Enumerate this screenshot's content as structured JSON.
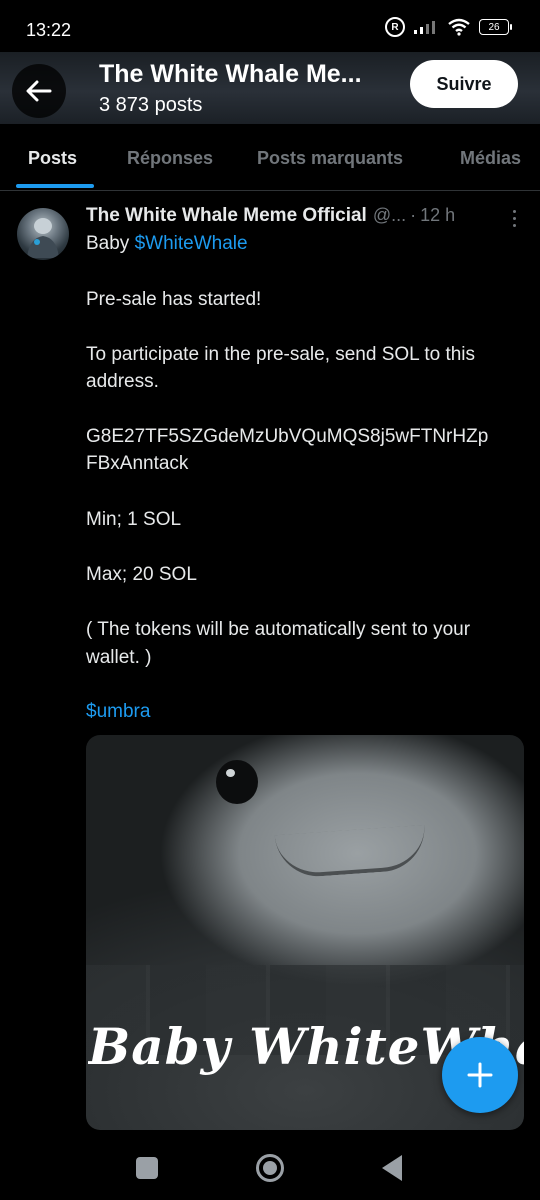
{
  "status_bar": {
    "time": "13:22",
    "r_badge": "R",
    "battery": "26"
  },
  "header": {
    "back_icon": "arrow-left-icon",
    "title": "The White Whale Me...",
    "post_count": "3 873 posts",
    "follow_label": "Suivre"
  },
  "tabs": [
    {
      "label": "Posts",
      "active": true
    },
    {
      "label": "Réponses",
      "active": false
    },
    {
      "label": "Posts marquants",
      "active": false
    },
    {
      "label": "Médias",
      "active": false
    }
  ],
  "post": {
    "author_name": "The White Whale Meme Official",
    "handle": "@...",
    "separator": "·",
    "time": "12 h",
    "lines": {
      "l1_prefix": "Baby ",
      "l1_link": "$WhiteWhale",
      "l2": "Pre-sale has started!",
      "l3": "To participate in the pre-sale, send SOL to this",
      "l4": "address.",
      "l5": "G8E27TF5SZGdeMzUbVQuMQS8j5wFTNrHZp",
      "l6": "FBxAnntack",
      "l7": "Min; 1 SOL",
      "l8": "Max; 20 SOL",
      "l9": "( The tokens will be automatically sent to your",
      "l10": "wallet. )",
      "l11_link": "$umbra"
    },
    "media_caption": "Baby WhiteWhale"
  },
  "fab_icon": "plus-icon",
  "colors": {
    "accent": "#1d9bf0",
    "text": "#e7e9ea",
    "muted": "#71767b",
    "background": "#000000"
  }
}
